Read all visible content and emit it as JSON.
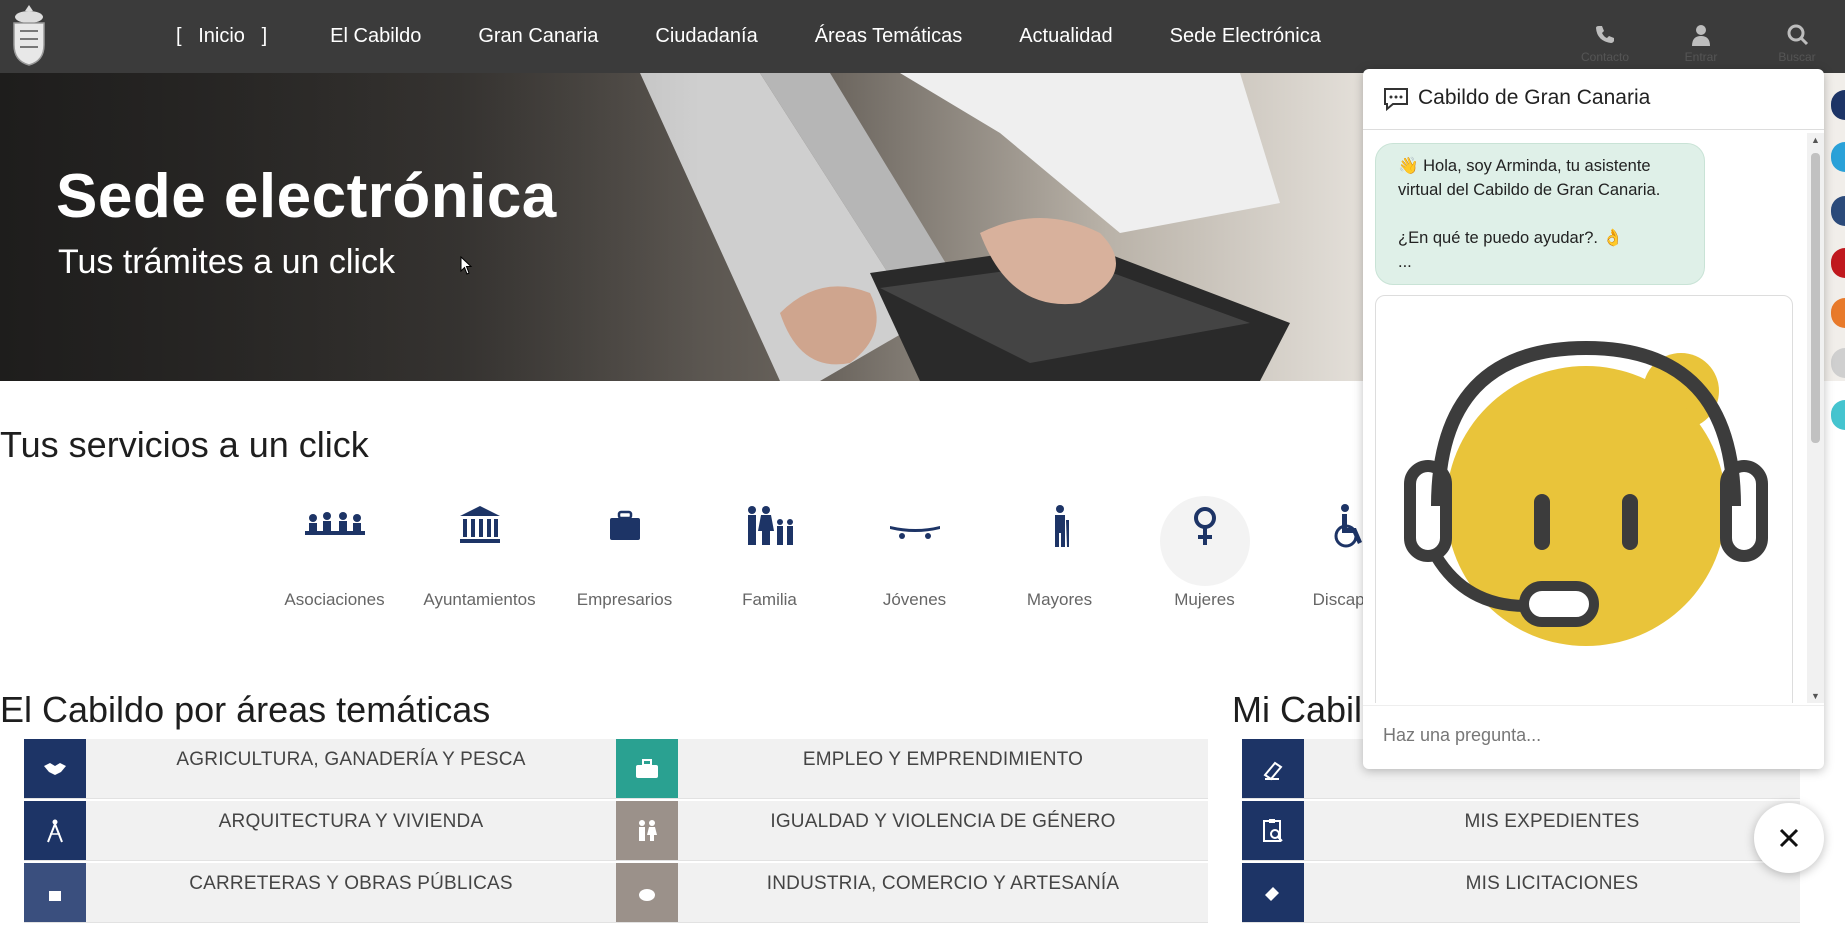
{
  "nav": {
    "items": [
      {
        "label": "Inicio",
        "active": true
      },
      {
        "label": "El Cabildo"
      },
      {
        "label": "Gran Canaria"
      },
      {
        "label": "Ciudadanía"
      },
      {
        "label": "Áreas Temáticas"
      },
      {
        "label": "Actualidad"
      },
      {
        "label": "Sede Electrónica"
      }
    ],
    "tools": [
      {
        "label": "Contacto",
        "icon": "phone-icon"
      },
      {
        "label": "Entrar",
        "icon": "user-icon"
      },
      {
        "label": "Buscar",
        "icon": "search-icon"
      }
    ]
  },
  "hero": {
    "title": "Sede electrónica",
    "subtitle": "Tus trámites a un click"
  },
  "services": {
    "title": "Tus servicios a un click",
    "items": [
      {
        "label": "Asociaciones",
        "icon": "people-meeting-icon"
      },
      {
        "label": "Ayuntamientos",
        "icon": "building-columns-icon"
      },
      {
        "label": "Empresarios",
        "icon": "briefcase-icon"
      },
      {
        "label": "Familia",
        "icon": "family-icon"
      },
      {
        "label": "Jóvenes",
        "icon": "skateboard-icon"
      },
      {
        "label": "Mayores",
        "icon": "elderly-icon"
      },
      {
        "label": "Mujeres",
        "icon": "female-symbol-icon"
      },
      {
        "label": "Discapaci",
        "icon": "wheelchair-icon"
      }
    ]
  },
  "areas": {
    "title": "El Cabildo por áreas temáticas",
    "left": [
      {
        "label": "AGRICULTURA, GANADERÍA Y PESCA",
        "color": "#1d3466"
      },
      {
        "label": "ARQUITECTURA Y VIVIENDA",
        "color": "#1d3466"
      },
      {
        "label": "CARRETERAS Y OBRAS PÚBLICAS",
        "color": "#3a4f7e"
      }
    ],
    "right": [
      {
        "label": "EMPLEO Y EMPRENDIMIENTO",
        "color": "#2aa191"
      },
      {
        "label": "IGUALDAD Y VIOLENCIA DE GÉNERO",
        "color": "#9b918a"
      },
      {
        "label": "INDUSTRIA, COMERCIO Y ARTESANÍA",
        "color": "#9b918a"
      }
    ]
  },
  "mi_cabildo": {
    "title": "Mi Cabil",
    "items": [
      {
        "label": "",
        "color": "#1d3466"
      },
      {
        "label": "MIS EXPEDIENTES",
        "color": "#1d3466"
      },
      {
        "label": "MIS LICITACIONES",
        "color": "#1d3466"
      }
    ]
  },
  "chat": {
    "title": "Cabildo de Gran Canaria",
    "message_line1": "👋 Hola, soy Arminda, tu asistente virtual del Cabildo de Gran Canaria.",
    "message_line2": "¿En qué te puedo ayudar?. 👌",
    "message_line3": "...",
    "input_placeholder": "Haz una pregunta...",
    "colors": {
      "bubble": "#dff0e8",
      "avatar_face": "#e9c43a"
    }
  },
  "colors": {
    "nav_bg": "#3b3b3b",
    "brand_blue": "#1d3466",
    "teal": "#2aa191"
  }
}
